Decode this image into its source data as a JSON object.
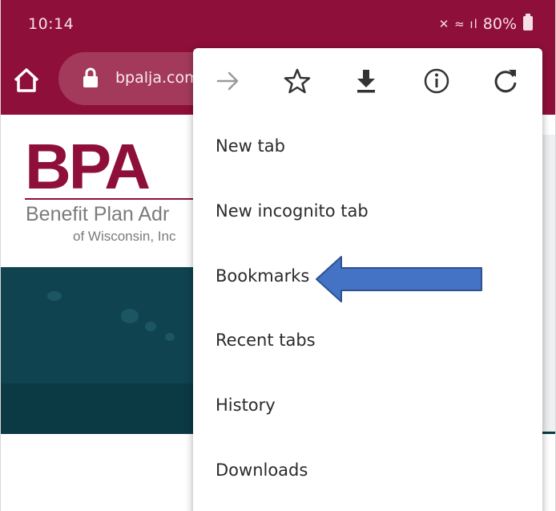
{
  "status_bar": {
    "time": "10:14",
    "battery_percent": "80%"
  },
  "toolbar": {
    "url": "bpalja.com"
  },
  "page": {
    "logo": "BPA",
    "logo_line1": "Benefit Plan Adr",
    "logo_line2": "of Wisconsin, Inc"
  },
  "menu": {
    "icons": [
      "forward-icon",
      "bookmark-star-icon",
      "download-icon",
      "info-icon",
      "refresh-icon"
    ],
    "items": [
      "New tab",
      "New incognito tab",
      "Bookmarks",
      "Recent tabs",
      "History",
      "Downloads"
    ]
  },
  "colors": {
    "brand": "#8e0f3a",
    "hero": "#0f4350",
    "arrow": "#4472c4"
  }
}
